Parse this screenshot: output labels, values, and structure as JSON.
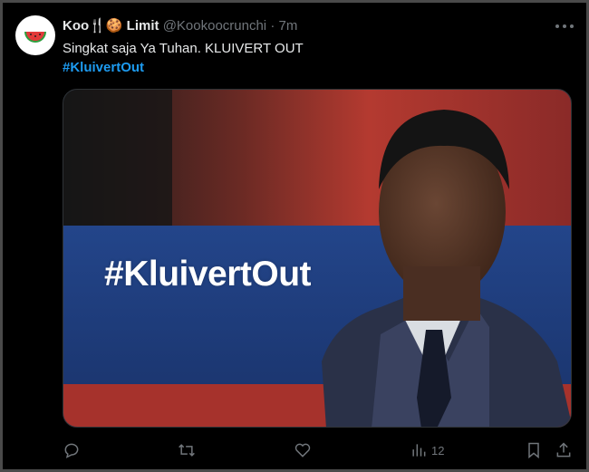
{
  "tweet": {
    "display_name": "Koo🍴🍪 Limit",
    "handle": "@Kookoocrunchi",
    "separator": "·",
    "time": "7m",
    "text": "Singkat saja Ya Tuhan. KLUIVERT OUT",
    "hashtag": "#KluivertOut",
    "media_overlay_text": "#KluivertOut"
  },
  "actions": {
    "views_count": "12"
  },
  "colors": {
    "background": "#000000",
    "accent": "#1d9bf0",
    "secondary_text": "#71767b",
    "media_banner": "#1f3d7a"
  },
  "icons": [
    "watermelon-avatar-icon",
    "more-icon",
    "reply-icon",
    "retweet-icon",
    "like-icon",
    "views-icon",
    "bookmark-icon",
    "share-icon"
  ]
}
